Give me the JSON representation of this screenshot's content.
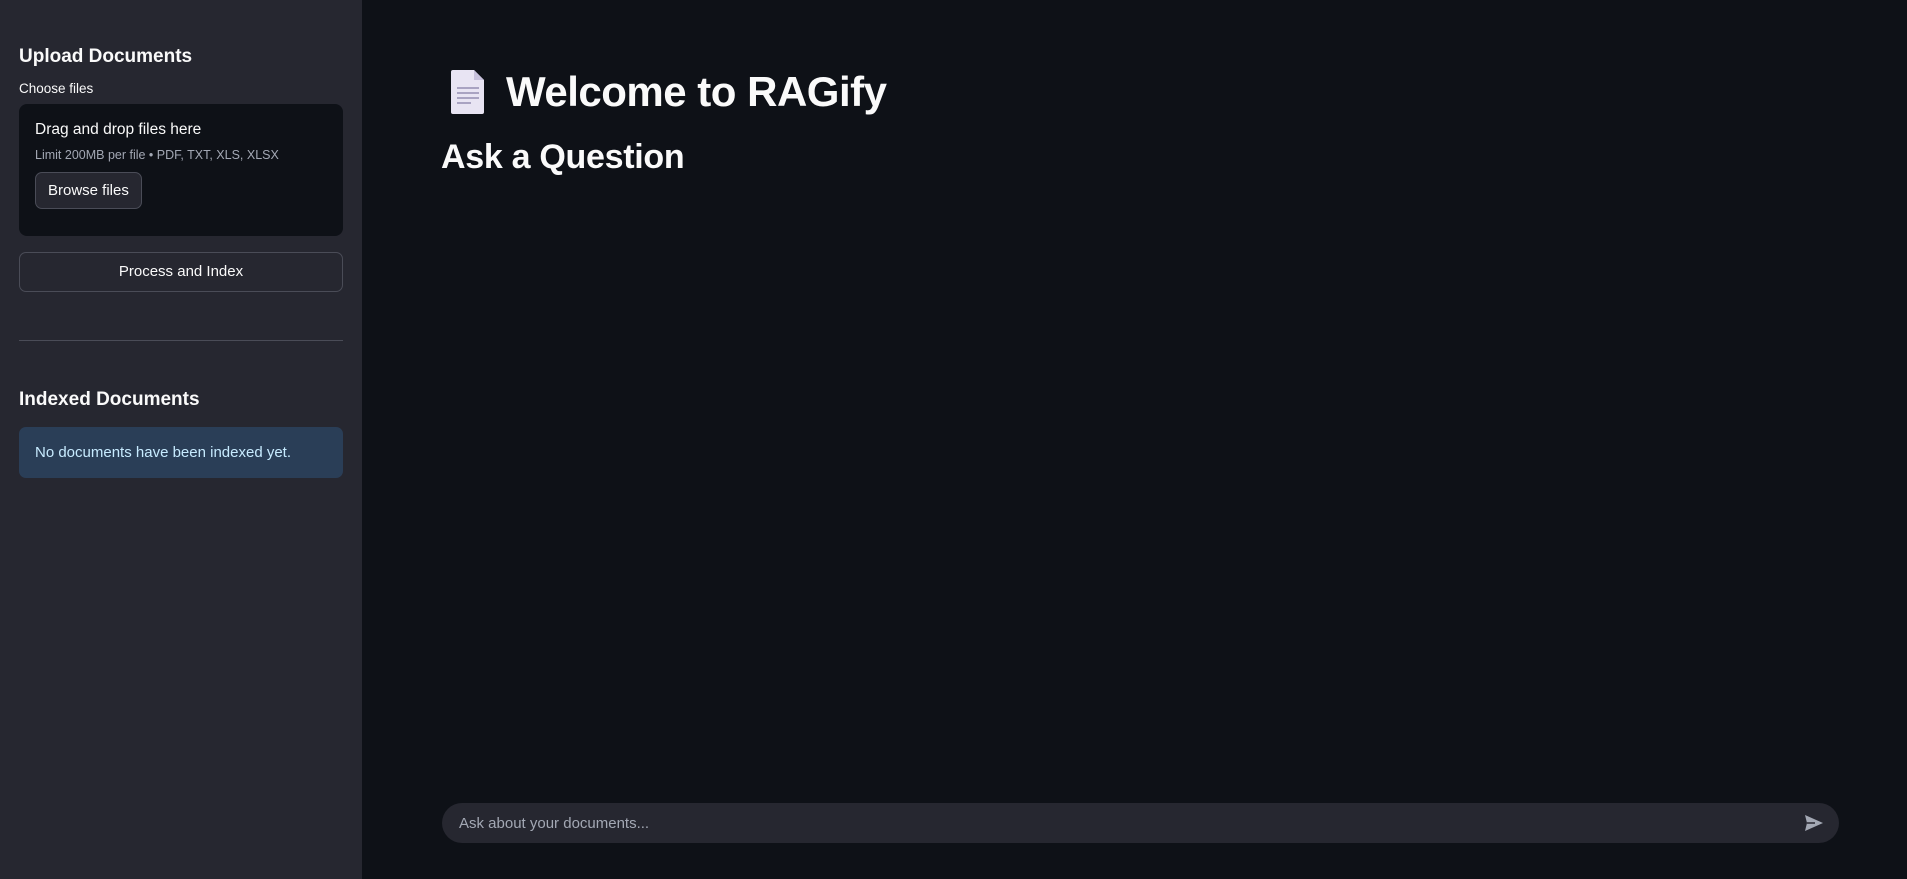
{
  "sidebar": {
    "upload_heading": "Upload Documents",
    "choose_label": "Choose files",
    "dropzone": {
      "title": "Drag and drop files here",
      "limit": "Limit 200MB per file • PDF, TXT, XLS, XLSX",
      "browse_label": "Browse files"
    },
    "process_label": "Process and Index",
    "indexed_heading": "Indexed Documents",
    "indexed_info": "No documents have been indexed yet."
  },
  "main": {
    "title_icon": "document-icon",
    "title": "Welcome to RAGify",
    "subtitle": "Ask a Question"
  },
  "chat": {
    "placeholder": "Ask about your documents...",
    "send_icon": "send-icon"
  },
  "colors": {
    "background": "#0e1117",
    "sidebar": "#262730",
    "info_bg": "#1f3a5a",
    "info_text": "#c7ebff"
  }
}
